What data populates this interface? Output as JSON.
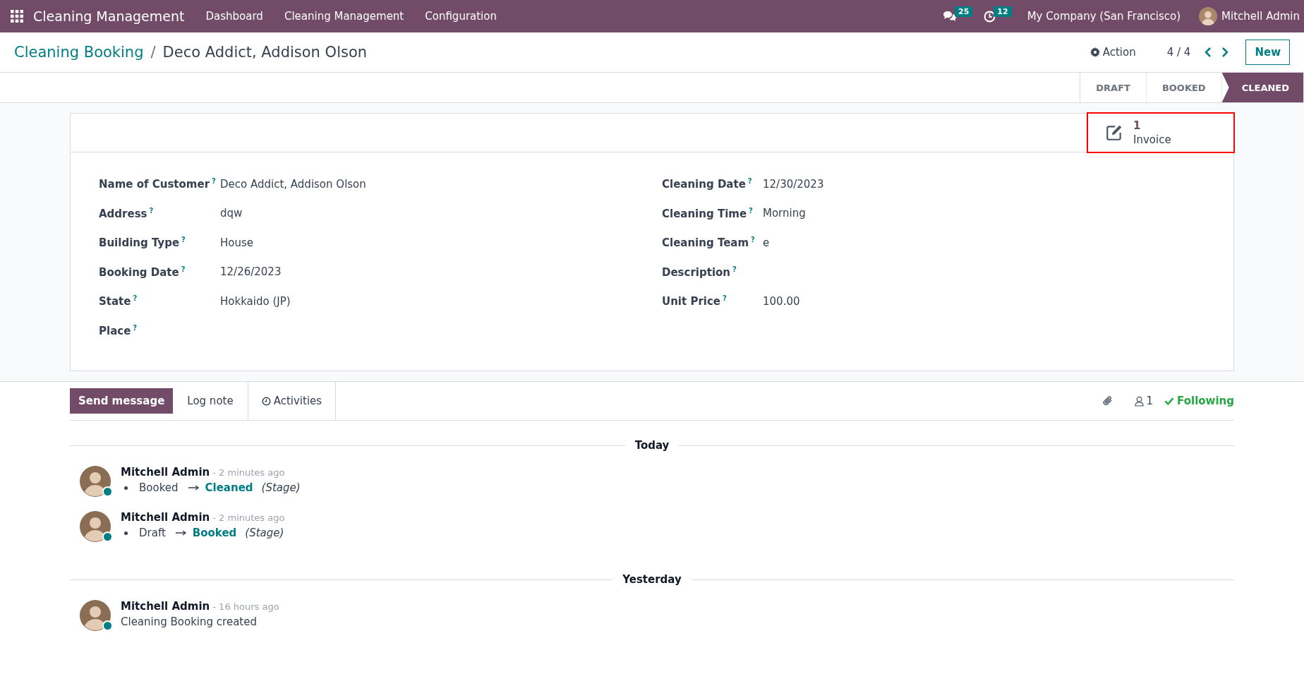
{
  "navbar": {
    "app_name": "Cleaning Management",
    "menu": [
      "Dashboard",
      "Cleaning Management",
      "Configuration"
    ],
    "messages_count": "25",
    "activities_count": "12",
    "company": "My Company (San Francisco)",
    "user": "Mitchell Admin"
  },
  "control_panel": {
    "breadcrumb": "Cleaning Booking",
    "separator": "/",
    "title": "Deco Addict, Addison Olson",
    "action": "Action",
    "pager": "4 / 4",
    "new_button": "New"
  },
  "stages": [
    {
      "label": "DRAFT",
      "selected": false
    },
    {
      "label": "BOOKED",
      "selected": false
    },
    {
      "label": "CLEANED",
      "selected": true
    }
  ],
  "smart_buttons": [
    {
      "value": "1",
      "label": "Invoice",
      "highlighted": true
    }
  ],
  "fields_left": [
    {
      "label": "Name of Customer",
      "help": "?",
      "value": "Deco Addict, Addison Olson"
    },
    {
      "label": "Address",
      "help": "?",
      "value": "dqw"
    },
    {
      "label": "Building Type",
      "help": "?",
      "value": "House"
    },
    {
      "label": "Booking Date",
      "help": "?",
      "value": "12/26/2023"
    },
    {
      "label": "State",
      "help": "?",
      "value": "Hokkaido (JP)"
    },
    {
      "label": "Place",
      "help": "?"
    }
  ],
  "fields_right": [
    {
      "label": "Cleaning Date",
      "help": "?",
      "value": "12/30/2023"
    },
    {
      "label": "Cleaning Time",
      "help": "?",
      "value": "Morning"
    },
    {
      "label": "Cleaning Team",
      "help": "?",
      "value": "e"
    },
    {
      "label": "Description",
      "help": "?"
    },
    {
      "label": "Unit Price",
      "help": "?",
      "value": "100.00"
    }
  ],
  "chatter": {
    "buttons": [
      {
        "label": "Send message",
        "kind": "primary"
      },
      {
        "label": "Log note",
        "kind": "plain"
      },
      {
        "label": "Activities",
        "kind": "tab"
      }
    ],
    "follower_count": "1",
    "follow": "Following",
    "groups": [
      {
        "date": "Today",
        "messages": [
          {
            "author": "Mitchell Admin",
            "time": "- 2 minutes ago",
            "kind": "tracking",
            "old": "Booked",
            "new": "Cleaned",
            "field": "(Stage)"
          },
          {
            "author": "Mitchell Admin",
            "time": "- 2 minutes ago",
            "kind": "tracking",
            "old": "Draft",
            "new": "Booked",
            "field": "(Stage)"
          }
        ]
      },
      {
        "date": "Yesterday",
        "messages": [
          {
            "author": "Mitchell Admin",
            "time": "- 16 hours ago",
            "kind": "text",
            "body": "Cleaning Booking created"
          }
        ]
      }
    ]
  }
}
